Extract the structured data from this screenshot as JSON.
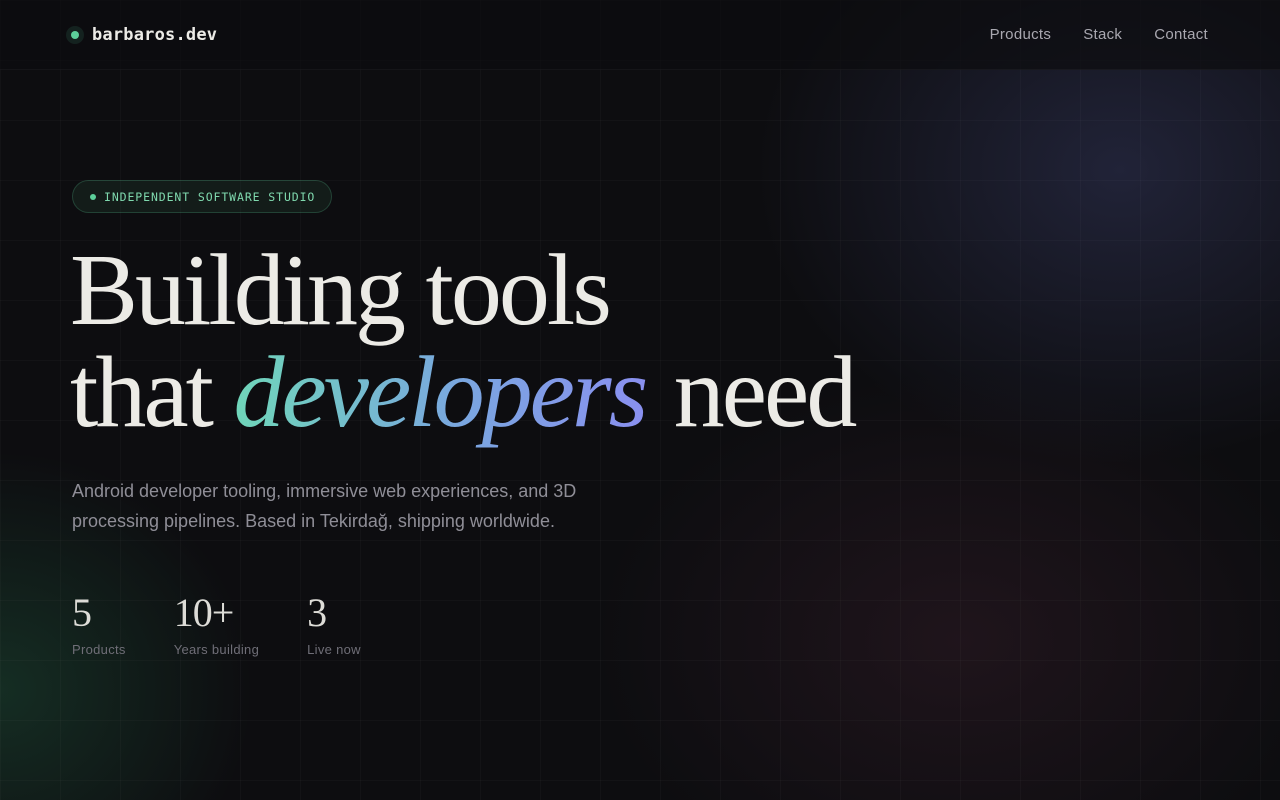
{
  "header": {
    "logo_text": "barbaros.dev",
    "nav": [
      "Products",
      "Stack",
      "Contact"
    ]
  },
  "hero": {
    "badge": "INDEPENDENT SOFTWARE STUDIO",
    "title_line1": "Building tools",
    "title_line2_pre": "that ",
    "title_accent": "developers",
    "title_line2_post": " need",
    "lede": "Android developer tooling, immersive web experiences, and 3D processing pipelines. Based in Tekirdağ, shipping worldwide."
  },
  "stats": [
    {
      "value": "5",
      "label": "Products"
    },
    {
      "value": "10+",
      "label": "Years building"
    },
    {
      "value": "3",
      "label": "Live now"
    }
  ],
  "colors": {
    "background": "#0d0d10",
    "accent_green": "#5ccf9a",
    "gradient_start": "#6fd6b9",
    "gradient_end": "#8a8ff0"
  }
}
